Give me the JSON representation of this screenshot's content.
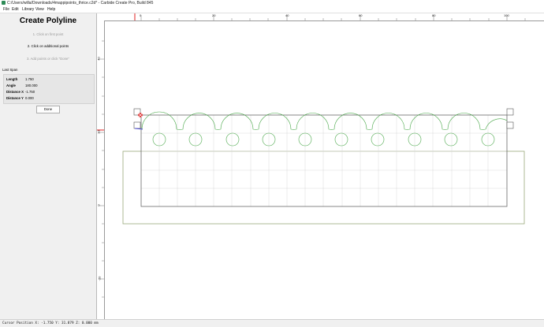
{
  "window": {
    "title": "C:/Users/willa/Downloads/4mappipoints_thrice.c2d* - Carbide Create Pro, Build 845"
  },
  "menu": [
    "File",
    "Edit",
    "Library",
    "View",
    "Help"
  ],
  "panel": {
    "heading": "Create Polyline",
    "steps": [
      "1. Click on first point",
      "2. Click on additional points",
      "3. Add points or click \"Done\""
    ],
    "last_span_label": "Last Span",
    "rows": [
      {
        "key": "Length",
        "value": "1.750"
      },
      {
        "key": "Angle",
        "value": "180.000"
      },
      {
        "key": "Distance X",
        "value": "-1.750"
      },
      {
        "key": "Distance Y",
        "value": "0.000"
      }
    ],
    "done_label": "Done"
  },
  "ruler": {
    "top_labels": [
      "0",
      "20",
      "40",
      "60",
      "80",
      "100"
    ],
    "left_labels": [
      "40",
      "20",
      "0",
      "-20"
    ]
  },
  "colors": {
    "toolpath": "#4aa84a",
    "stock": "#9aa97a",
    "grid": "#d9d9d9",
    "cursor_marker": "#e02020",
    "selection": "#4a4ad0"
  },
  "status": {
    "cursor": "Cursor Position X: -1.750  Y: 31.879  Z: 0.000 mm"
  }
}
